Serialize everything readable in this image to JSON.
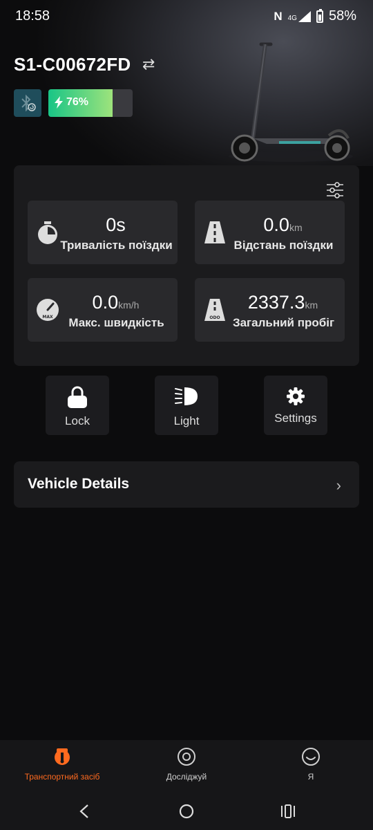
{
  "status_bar": {
    "time": "18:58",
    "network": "4G",
    "battery": "58%"
  },
  "device": {
    "name": "S1-C00672FD",
    "battery_percent": 76,
    "battery_text": "76%"
  },
  "stats": [
    {
      "value": "0s",
      "unit": "",
      "label": "Тривалість поїздки",
      "icon": "stopwatch-icon"
    },
    {
      "value": "0.0",
      "unit": "km",
      "label": "Відстань поїздки",
      "icon": "road-icon"
    },
    {
      "value": "0.0",
      "unit": "km/h",
      "label": "Макс. швидкість",
      "icon": "speedometer-icon"
    },
    {
      "value": "2337.3",
      "unit": "km",
      "label": "Загальний пробіг",
      "icon": "odometer-road-icon"
    }
  ],
  "actions": {
    "lock": "Lock",
    "light": "Light",
    "settings": "Settings"
  },
  "details": {
    "title": "Vehicle Details"
  },
  "bottom_nav": [
    {
      "label": "Транспортний засіб",
      "active": true
    },
    {
      "label": "Досліджуй",
      "active": false
    },
    {
      "label": "Я",
      "active": false
    }
  ],
  "colors": {
    "accent": "#ff6a1f",
    "battery_start": "#19c586",
    "battery_end": "#9ee37c",
    "bt_badge": "#1f4d5b"
  },
  "odometer_icon_text": {
    "max": "MAX",
    "odo": "ODO"
  }
}
